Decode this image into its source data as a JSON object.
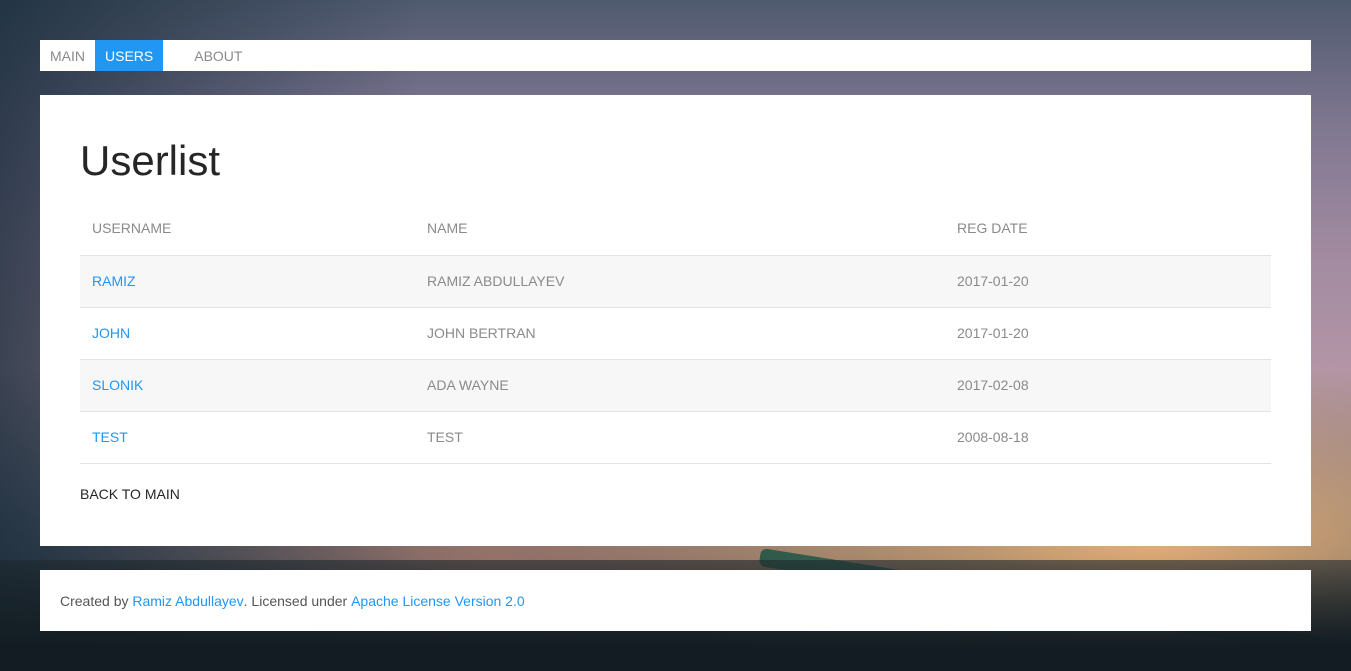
{
  "nav": {
    "items": [
      {
        "label": "MAIN"
      },
      {
        "label": "USERS"
      },
      {
        "label": "ABOUT"
      }
    ]
  },
  "main": {
    "title": "Userlist",
    "columns": [
      "USERNAME",
      "NAME",
      "REG DATE"
    ],
    "rows": [
      {
        "username": "RAMIZ",
        "name": "RAMIZ ABDULLAYEV",
        "reg_date": "2017-01-20"
      },
      {
        "username": "JOHN",
        "name": "JOHN BERTRAN",
        "reg_date": "2017-01-20"
      },
      {
        "username": "SLONIK",
        "name": "ADA WAYNE",
        "reg_date": "2017-02-08"
      },
      {
        "username": "TEST",
        "name": "TEST",
        "reg_date": "2008-08-18"
      }
    ],
    "back_label": "BACK TO MAIN"
  },
  "footer": {
    "prefix": "Created by ",
    "author": "Ramiz Abdullayev",
    "middle": ". Licensed under ",
    "license": "Apache License Version 2.0"
  },
  "colors": {
    "accent": "#2196f3"
  }
}
